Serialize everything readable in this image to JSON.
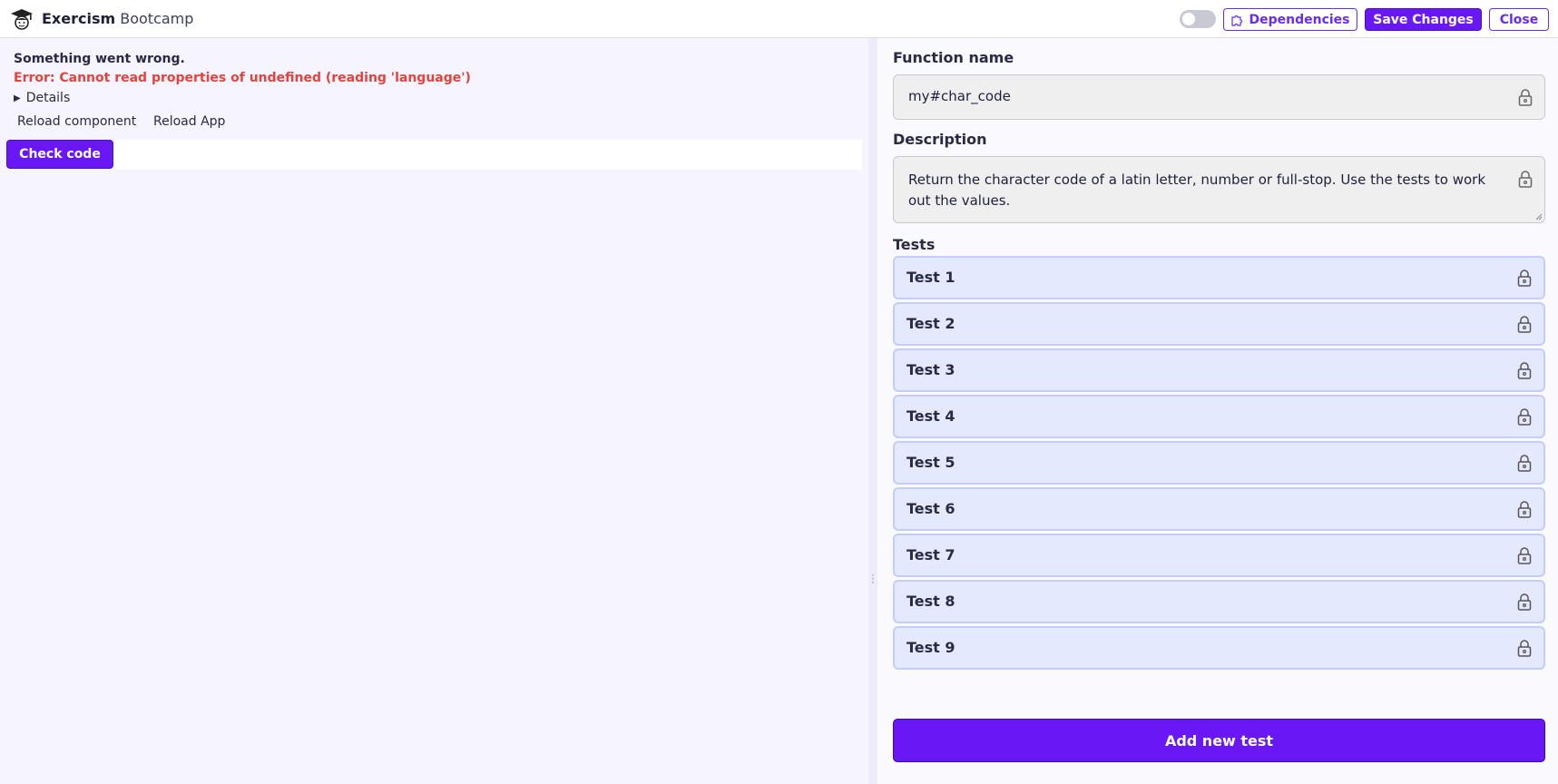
{
  "header": {
    "brand_bold": "Exercism",
    "brand_light": "Bootcamp",
    "logo_icon": "graduate-cap-icon",
    "toggle_on": false,
    "dependencies_label": "Dependencies",
    "save_label": "Save Changes",
    "close_label": "Close"
  },
  "left": {
    "error_title": "Something went wrong.",
    "error_message": "Error: Cannot read properties of undefined (reading 'language')",
    "details_label": "Details",
    "reload_component_label": "Reload component",
    "reload_app_label": "Reload App",
    "check_code_label": "Check code"
  },
  "right": {
    "function_name_label": "Function name",
    "function_name_value": "my#char_code",
    "description_label": "Description",
    "description_value": "Return the character code of a latin letter, number or full-stop. Use the tests to work out the values.",
    "tests_label": "Tests",
    "tests": [
      {
        "label": "Test 1"
      },
      {
        "label": "Test 2"
      },
      {
        "label": "Test 3"
      },
      {
        "label": "Test 4"
      },
      {
        "label": "Test 5"
      },
      {
        "label": "Test 6"
      },
      {
        "label": "Test 7"
      },
      {
        "label": "Test 8"
      },
      {
        "label": "Test 9"
      }
    ],
    "add_test_label": "Add new test"
  },
  "colors": {
    "accent": "#6a17f5",
    "error": "#e0443a",
    "test_bg": "#e5e9fd",
    "test_border": "#c3cdfb"
  }
}
